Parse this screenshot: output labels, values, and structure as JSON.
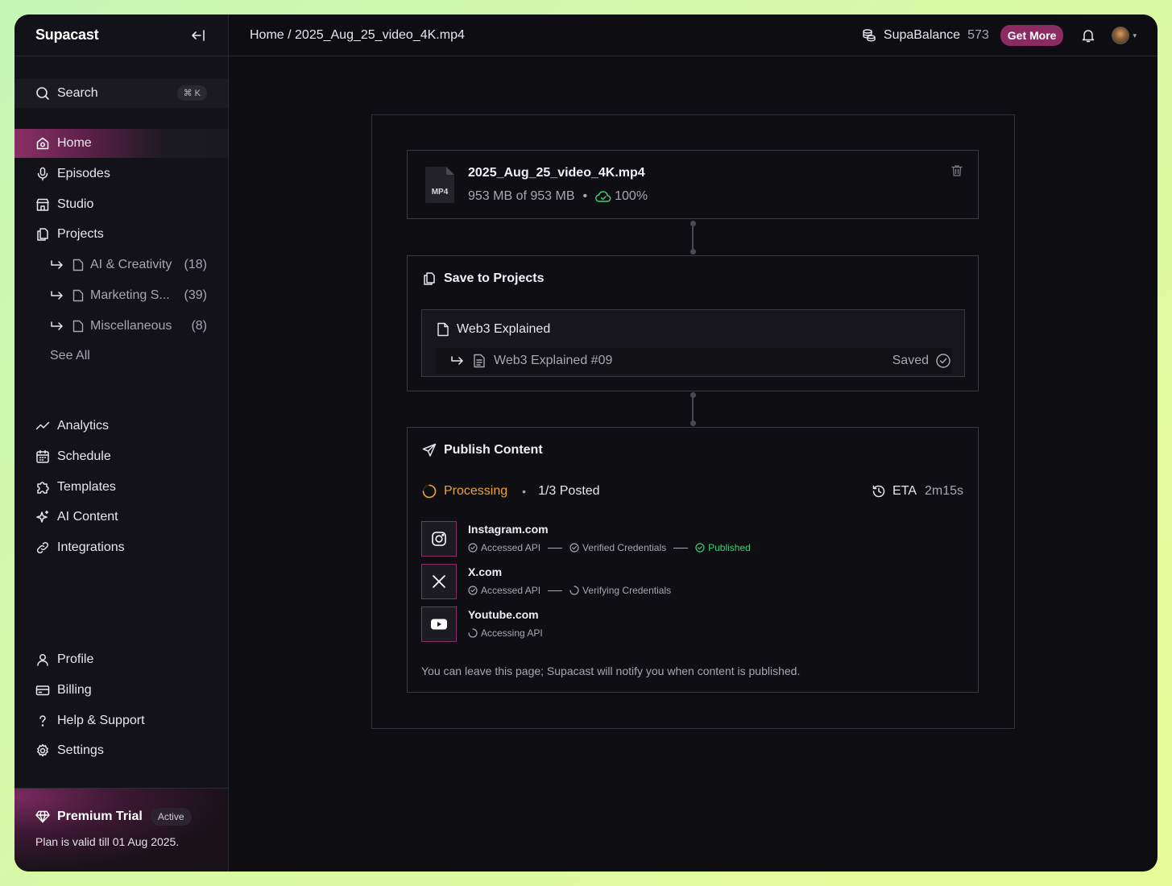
{
  "app": {
    "brand": "Supacast"
  },
  "search": {
    "label": "Search",
    "shortcut": "⌘ K"
  },
  "sidebar": {
    "primary": [
      {
        "label": "Home",
        "icon": "home-icon",
        "active": true
      },
      {
        "label": "Episodes",
        "icon": "mic-icon"
      },
      {
        "label": "Studio",
        "icon": "studio-icon"
      },
      {
        "label": "Projects",
        "icon": "projects-icon"
      }
    ],
    "projects": [
      {
        "label": "AI & Creativity",
        "count": "(18)"
      },
      {
        "label": "Marketing S...",
        "count": "(39)"
      },
      {
        "label": "Miscellaneous",
        "count": "(8)"
      }
    ],
    "see_all": "See All",
    "secondary": [
      {
        "label": "Analytics",
        "icon": "analytics-icon"
      },
      {
        "label": "Schedule",
        "icon": "calendar-icon"
      },
      {
        "label": "Templates",
        "icon": "puzzle-icon"
      },
      {
        "label": "AI Content",
        "icon": "sparkle-icon"
      },
      {
        "label": "Integrations",
        "icon": "link-icon"
      }
    ],
    "account": [
      {
        "label": "Profile",
        "icon": "user-icon"
      },
      {
        "label": "Billing",
        "icon": "card-icon"
      },
      {
        "label": "Help & Support",
        "icon": "question-icon"
      },
      {
        "label": "Settings",
        "icon": "gear-icon"
      }
    ],
    "premium": {
      "title": "Premium Trial",
      "badge": "Active",
      "plan": "Plan is valid till 01 Aug 2025."
    }
  },
  "topbar": {
    "breadcrumb": "Home / 2025_Aug_25_video_4K.mp4",
    "balance_label": "SupaBalance",
    "balance_value": "573",
    "get_more": "Get More"
  },
  "file": {
    "type_label": "MP4",
    "name": "2025_Aug_25_video_4K.mp4",
    "size": "953 MB of 953 MB",
    "progress": "100%"
  },
  "save": {
    "title": "Save to Projects",
    "project": "Web3 Explained",
    "episode": "Web3 Explained #09",
    "status": "Saved"
  },
  "publish": {
    "title": "Publish Content",
    "status": "Processing",
    "posted": "1/3 Posted",
    "eta_label": "ETA",
    "eta_value": "2m15s",
    "platforms": [
      {
        "name": "Instagram.com",
        "icon": "instagram-icon",
        "steps": [
          {
            "label": "Accessed API",
            "state": "done"
          },
          {
            "label": "Verified Credentials",
            "state": "done"
          },
          {
            "label": "Published",
            "state": "published"
          }
        ]
      },
      {
        "name": "X.com",
        "icon": "x-icon",
        "steps": [
          {
            "label": "Accessed API",
            "state": "done"
          },
          {
            "label": "Verifying Credentials",
            "state": "pending"
          }
        ]
      },
      {
        "name": "Youtube.com",
        "icon": "youtube-icon",
        "steps": [
          {
            "label": "Accessing API",
            "state": "pending"
          }
        ]
      }
    ],
    "note": "You can leave this page; Supacast will notify you when content is published."
  },
  "colors": {
    "accent": "#8c2a62",
    "processing": "#f2a037",
    "success": "#3ecf76"
  }
}
